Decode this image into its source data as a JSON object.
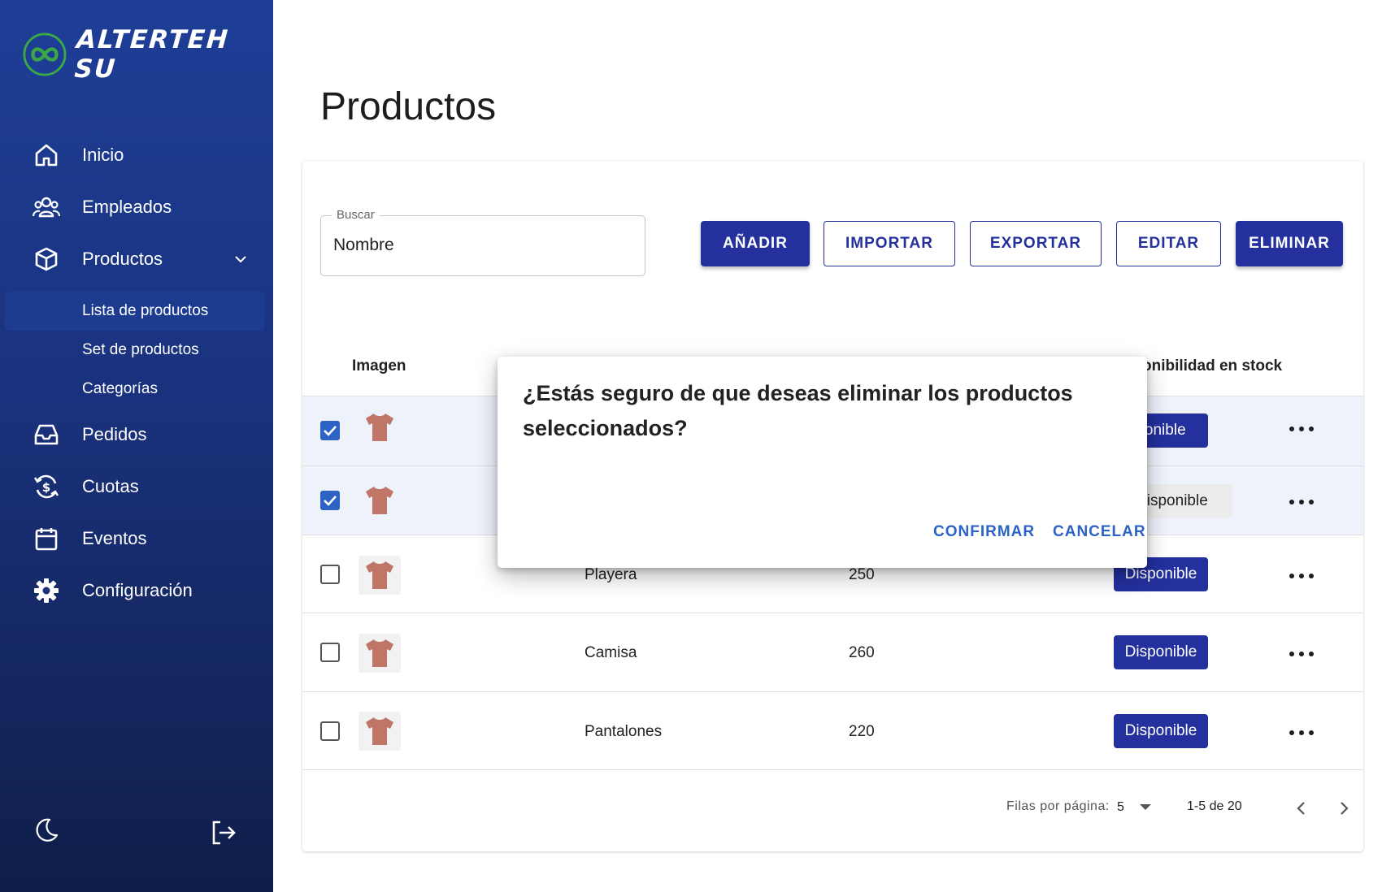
{
  "brand": {
    "name": "ALTERTEH SU"
  },
  "colors": {
    "primary": "#23309e",
    "sidebar_top": "#1e3e97",
    "sidebar_bottom": "#0f1e49",
    "dialog_action": "#2d63c5",
    "checkbox": "#2d63c5"
  },
  "sidebar": {
    "items": [
      {
        "label": "Inicio",
        "icon": "home-icon"
      },
      {
        "label": "Empleados",
        "icon": "users-icon"
      },
      {
        "label": "Productos",
        "icon": "box-icon",
        "expanded": true
      },
      {
        "label": "Pedidos",
        "icon": "inbox-icon"
      },
      {
        "label": "Cuotas",
        "icon": "dollar-cycle-icon"
      },
      {
        "label": "Eventos",
        "icon": "calendar-icon"
      },
      {
        "label": "Configuración",
        "icon": "gear-icon"
      }
    ],
    "subitems": [
      {
        "label": "Lista de productos",
        "active": true
      },
      {
        "label": "Set de productos"
      },
      {
        "label": "Categorías"
      }
    ],
    "bottom": {
      "theme_icon": "moon-icon",
      "logout_icon": "logout-icon"
    }
  },
  "page": {
    "title": "Productos"
  },
  "search": {
    "legend": "Buscar",
    "value": "Nombre"
  },
  "toolbar": {
    "add": "AÑADIR",
    "import": "IMPORTAR",
    "export": "EXPORTAR",
    "edit": "EDITAR",
    "delete": "ELIMINAR"
  },
  "table": {
    "columns": {
      "image": "Imagen",
      "stock": "onibilidad en stock"
    },
    "rows": [
      {
        "checked": true,
        "name": "",
        "price": "",
        "status": "ponible"
      },
      {
        "checked": true,
        "name": "",
        "price": "",
        "status": "disponible"
      },
      {
        "checked": false,
        "name": "Playera",
        "price": "250",
        "status": "Disponible"
      },
      {
        "checked": false,
        "name": "Camisa",
        "price": "260",
        "status": "Disponible"
      },
      {
        "checked": false,
        "name": "Pantalones",
        "price": "220",
        "status": "Disponible"
      }
    ]
  },
  "pagination": {
    "rows_label": "Filas por página:",
    "rows_value": "5",
    "range": "1-5 de 20"
  },
  "dialog": {
    "title": "¿Estás seguro de que deseas eliminar los productos seleccionados?",
    "confirm": "CONFIRMAR",
    "cancel": "CANCELAR"
  }
}
